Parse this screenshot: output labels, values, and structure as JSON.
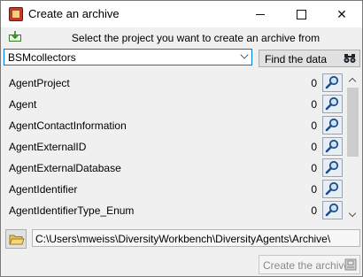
{
  "window": {
    "title": "Create an archive",
    "controls": {
      "minimize": "",
      "maximize": "",
      "close": "✕"
    }
  },
  "prompt": "Select the project you want to create an archive from",
  "project_select": {
    "value": "BSMcollectors"
  },
  "find_button": {
    "label": "Find the data",
    "icon": "binoculars-icon"
  },
  "tables": [
    {
      "name": "AgentProject",
      "count": "0"
    },
    {
      "name": "Agent",
      "count": "0"
    },
    {
      "name": "AgentContactInformation",
      "count": "0"
    },
    {
      "name": "AgentExternalID",
      "count": "0"
    },
    {
      "name": "AgentExternalDatabase",
      "count": "0"
    },
    {
      "name": "AgentIdentifier",
      "count": "0"
    },
    {
      "name": "AgentIdentifierType_Enum",
      "count": "0"
    }
  ],
  "archive_path": "C:\\Users\\mweiss\\DiversityWorkbench\\DiversityAgents\\Archive\\",
  "create_button": {
    "label": "Create the archive",
    "enabled": false
  },
  "colors": {
    "accent": "#0078d7",
    "disabled_text": "#8a8a8a"
  }
}
